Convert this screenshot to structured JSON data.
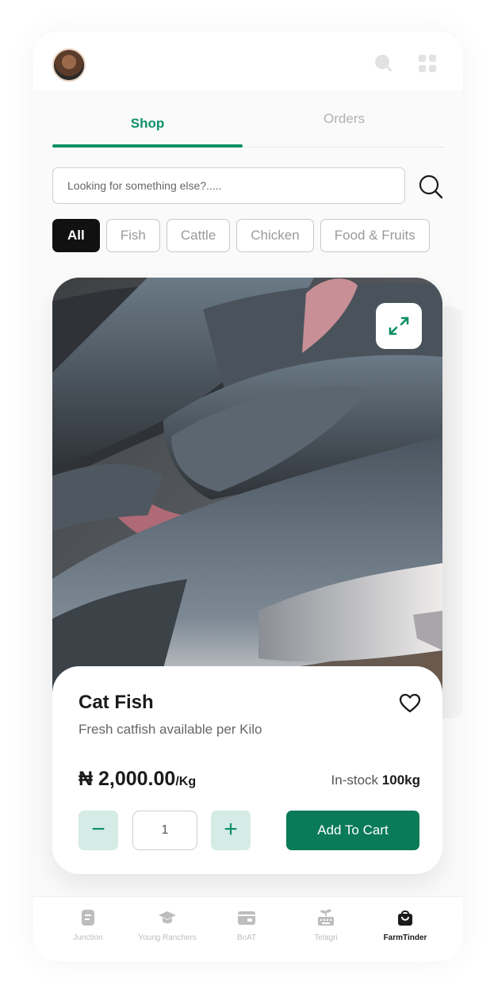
{
  "header": {
    "avatar_alt": "user-avatar"
  },
  "tabs": [
    {
      "label": "Shop",
      "active": true
    },
    {
      "label": "Orders",
      "active": false
    }
  ],
  "search": {
    "placeholder": "Looking for something else?....."
  },
  "categories": [
    "All",
    "Fish",
    "Cattle",
    "Chicken",
    "Food & Fruits"
  ],
  "active_category": "All",
  "product": {
    "name": "Cat Fish",
    "description": "Fresh catfish available per Kilo",
    "price": "₦ 2,000.00",
    "price_unit": "/Kg",
    "stock_label": "In-stock",
    "stock_value": "100kg",
    "quantity": "1",
    "minus_label": "−",
    "plus_label": "+",
    "add_to_cart_label": "Add To Cart"
  },
  "bottom_nav": [
    {
      "label": "Junction",
      "icon": "document-icon",
      "active": false
    },
    {
      "label": "Young Ranchers",
      "icon": "graduation-cap-icon",
      "active": false
    },
    {
      "label": "BoAT",
      "icon": "wallet-icon",
      "active": false
    },
    {
      "label": "Telagri",
      "icon": "seedling-keyboard-icon",
      "active": false
    },
    {
      "label": "FarmTinder",
      "icon": "shopping-bag-icon",
      "active": true
    }
  ],
  "colors": {
    "accent": "#0f8f67",
    "accent_dark": "#0a7a58",
    "accent_light": "#d5ebe5",
    "chip_active": "#111111"
  }
}
